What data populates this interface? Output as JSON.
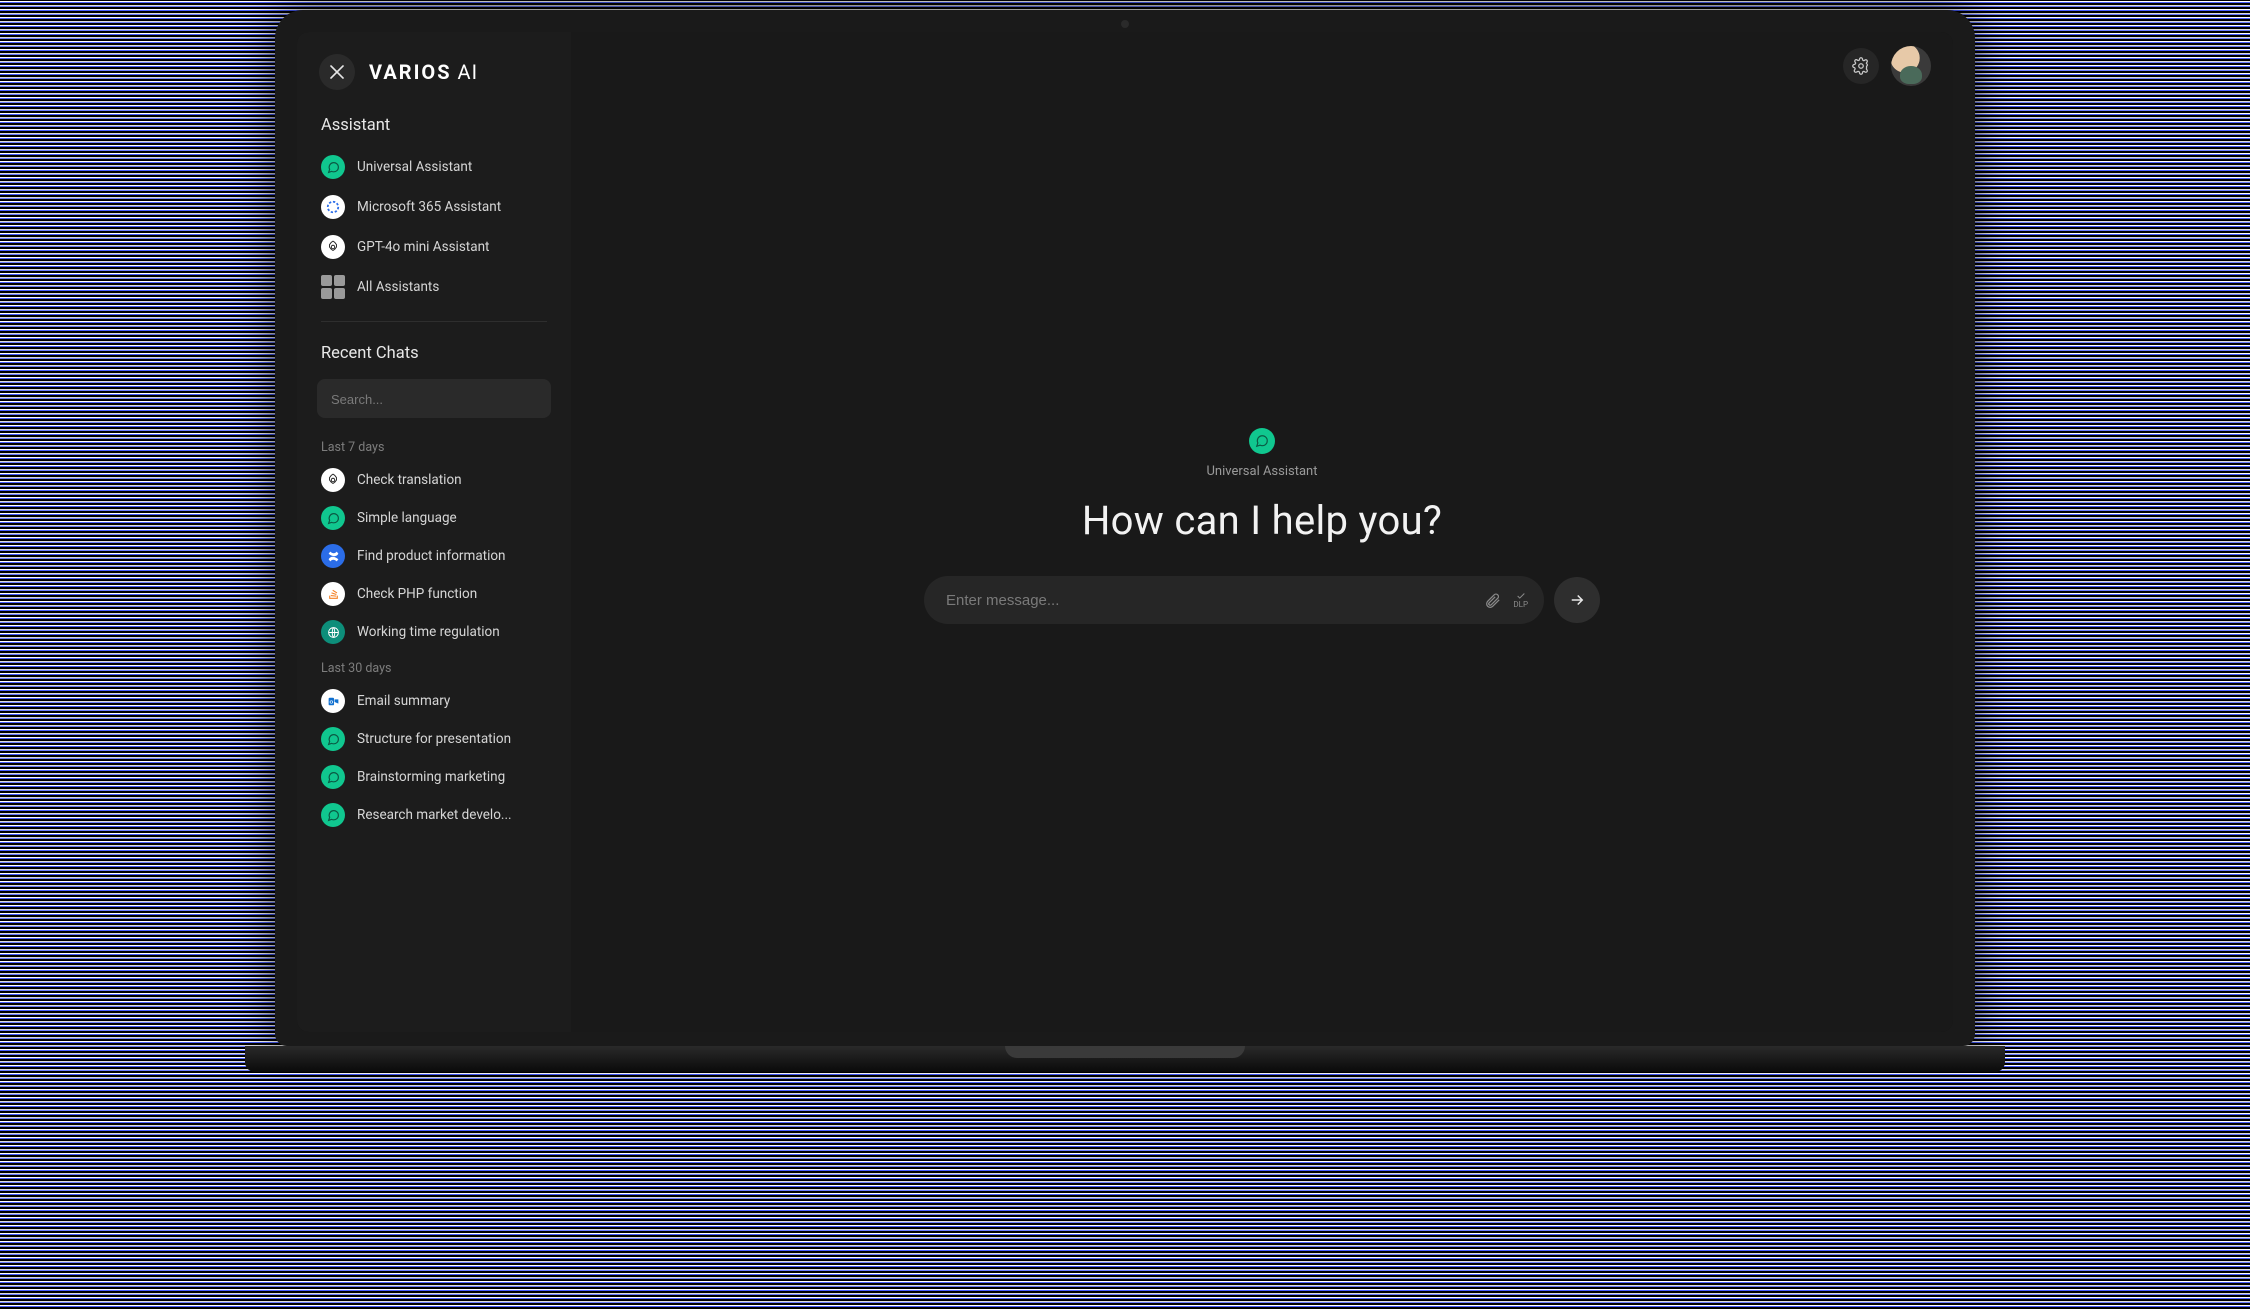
{
  "brand": {
    "bold": "VARIOS",
    "light": "AI"
  },
  "sidebar": {
    "assistant_section_title": "Assistant",
    "assistants": [
      {
        "label": "Universal Assistant",
        "icon": "chat-bubble-icon",
        "style": "green"
      },
      {
        "label": "Microsoft 365 Assistant",
        "icon": "copilot-icon",
        "style": "white"
      },
      {
        "label": "GPT-4o mini Assistant",
        "icon": "openai-icon",
        "style": "white"
      }
    ],
    "all_assistants_label": "All Assistants",
    "recent_section_title": "Recent Chats",
    "search_placeholder": "Search...",
    "groups": [
      {
        "title": "Last 7 days",
        "items": [
          {
            "label": "Check translation",
            "icon": "openai-icon",
            "style": "white"
          },
          {
            "label": "Simple language",
            "icon": "chat-bubble-icon",
            "style": "green"
          },
          {
            "label": "Find product information",
            "icon": "confluence-icon",
            "style": "blue"
          },
          {
            "label": "Check PHP function",
            "icon": "stackoverflow-icon",
            "style": "white"
          },
          {
            "label": "Working time regulation",
            "icon": "globe-icon",
            "style": "teal"
          }
        ]
      },
      {
        "title": "Last 30 days",
        "items": [
          {
            "label": "Email summary",
            "icon": "outlook-icon",
            "style": "outlook"
          },
          {
            "label": "Structure for presentation",
            "icon": "chat-bubble-icon",
            "style": "green"
          },
          {
            "label": "Brainstorming marketing",
            "icon": "chat-bubble-icon",
            "style": "green"
          },
          {
            "label": "Research market develo...",
            "icon": "chat-bubble-icon",
            "style": "green"
          }
        ]
      }
    ]
  },
  "main": {
    "current_assistant_label": "Universal Assistant",
    "hero_title": "How can I help you?",
    "input_placeholder": "Enter message...",
    "dlp_label": "DLP"
  }
}
